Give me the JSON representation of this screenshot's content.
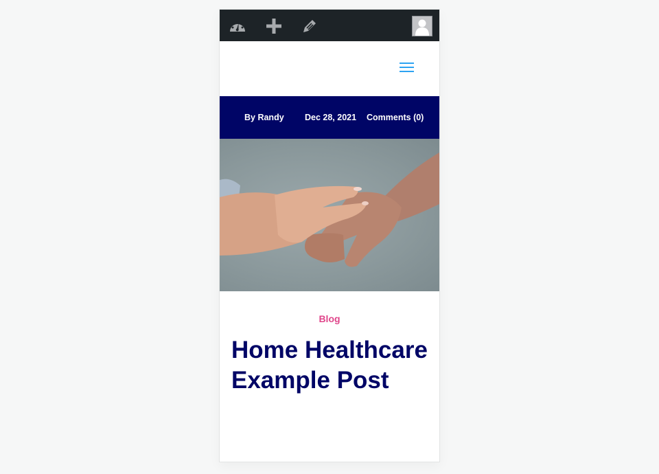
{
  "admin_bar": {
    "items": [
      {
        "name": "dashboard",
        "icon": "dashboard-gauge-icon"
      },
      {
        "name": "new",
        "icon": "plus-icon"
      },
      {
        "name": "edit",
        "icon": "pencil-icon"
      }
    ],
    "avatar_icon": "user-avatar-icon"
  },
  "header": {
    "menu_icon": "hamburger-menu-icon",
    "menu_color": "#2ea3f2"
  },
  "post_meta": {
    "author": "By Randy",
    "date": "Dec 28, 2021",
    "comments": "Comments (0)",
    "background": "#000566"
  },
  "featured_image": {
    "description": "Two hands holding each other against a grey background"
  },
  "post": {
    "category": "Blog",
    "category_color": "#e0468b",
    "title": "Home Healthcare Example Post",
    "title_color": "#000566"
  }
}
